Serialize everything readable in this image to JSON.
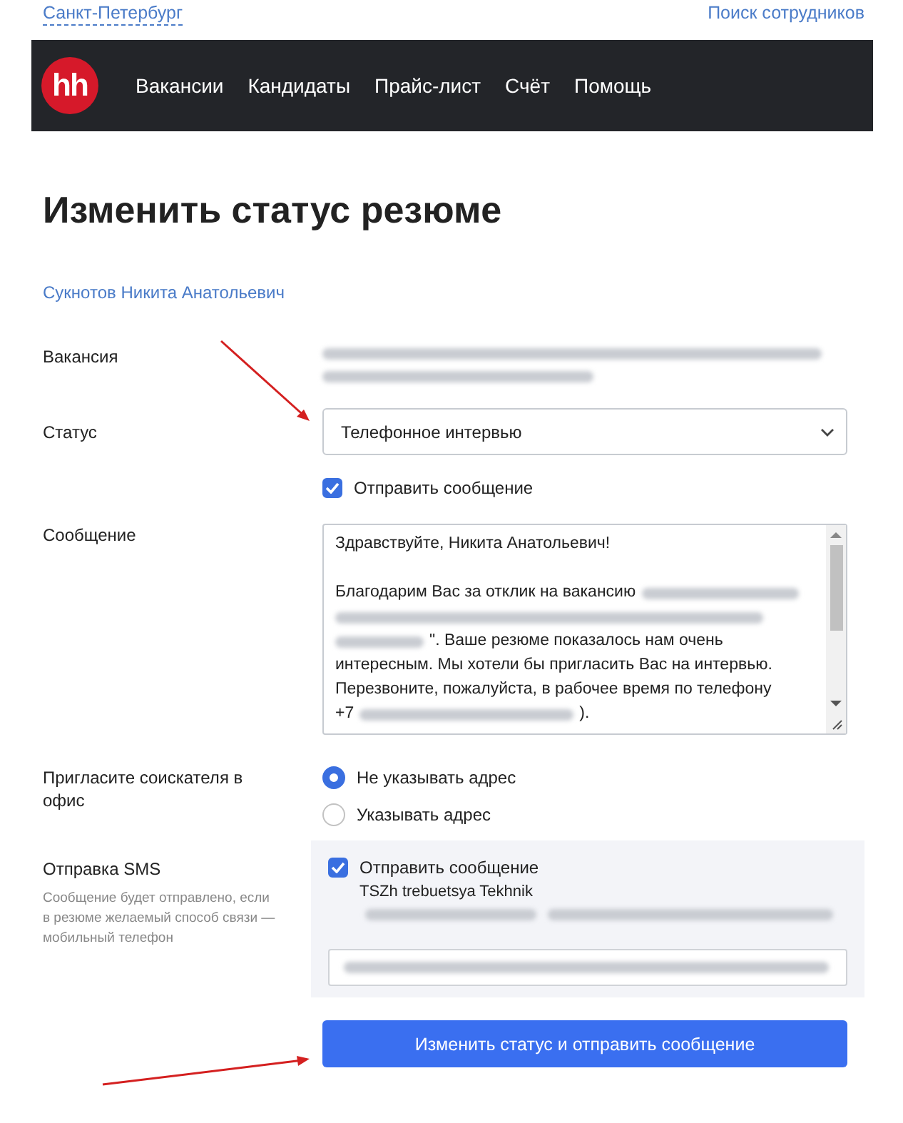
{
  "top_links": {
    "city": "Санкт-Петербург",
    "search": "Поиск сотрудников"
  },
  "nav": {
    "logo": "hh",
    "items": [
      {
        "label": "Вакансии"
      },
      {
        "label": "Кандидаты"
      },
      {
        "label": "Прайс-лист"
      },
      {
        "label": "Счёт"
      },
      {
        "label": "Помощь"
      }
    ]
  },
  "title": "Изменить статус резюме",
  "candidate": "Сукнотов Никита Анатольевич",
  "vacancy": {
    "label": "Вакансия",
    "value": {
      "kind": "redacted"
    }
  },
  "status": {
    "label": "Статус",
    "value": "Телефонное интервью",
    "send_message": {
      "label": "Отправить сообщение",
      "checked": true
    }
  },
  "message": {
    "label": "Сообщение",
    "lines": [
      {
        "kind": "text",
        "segments": [
          {
            "kind": "text",
            "text": "Здравствуйте, Никита Анатольевич!"
          }
        ]
      },
      {
        "kind": "blank"
      },
      {
        "kind": "text",
        "segments": [
          {
            "kind": "text",
            "text": "Благодарим Вас за отклик на вакансию"
          },
          {
            "kind": "redacted"
          }
        ]
      },
      {
        "kind": "text",
        "segments": [
          {
            "kind": "redacted"
          }
        ]
      },
      {
        "kind": "text",
        "segments": [
          {
            "kind": "redacted"
          },
          {
            "kind": "text",
            "text": "\". Ваше резюме показалось нам очень"
          }
        ]
      },
      {
        "kind": "text",
        "segments": [
          {
            "kind": "text",
            "text": "интересным. Мы хотели бы пригласить Вас на интервью."
          }
        ]
      },
      {
        "kind": "text",
        "segments": [
          {
            "kind": "text",
            "text": "Перезвоните, пожалуйста, в рабочее время по телефону"
          }
        ]
      },
      {
        "kind": "text",
        "segments": [
          {
            "kind": "text",
            "text": "+7"
          },
          {
            "kind": "redacted"
          },
          {
            "kind": "text",
            "text": ")."
          }
        ]
      }
    ]
  },
  "invite": {
    "label": "Пригласите соискателя в офис",
    "options": [
      {
        "label": "Не указывать адрес",
        "selected": true
      },
      {
        "label": "Указывать адрес",
        "selected": false
      }
    ]
  },
  "sms": {
    "label": "Отправка SMS",
    "hint": "Сообщение будет отправлено, если в резюме желаемый способ связи — мобильный телефон",
    "send": {
      "label": "Отправить сообщение",
      "checked": true
    },
    "preview": [
      {
        "kind": "text",
        "text": "TSZh trebuetsya Tekhnik"
      },
      {
        "kind": "redacted"
      }
    ],
    "field": {
      "kind": "redacted"
    }
  },
  "submit": "Изменить статус и отправить сообщение"
}
